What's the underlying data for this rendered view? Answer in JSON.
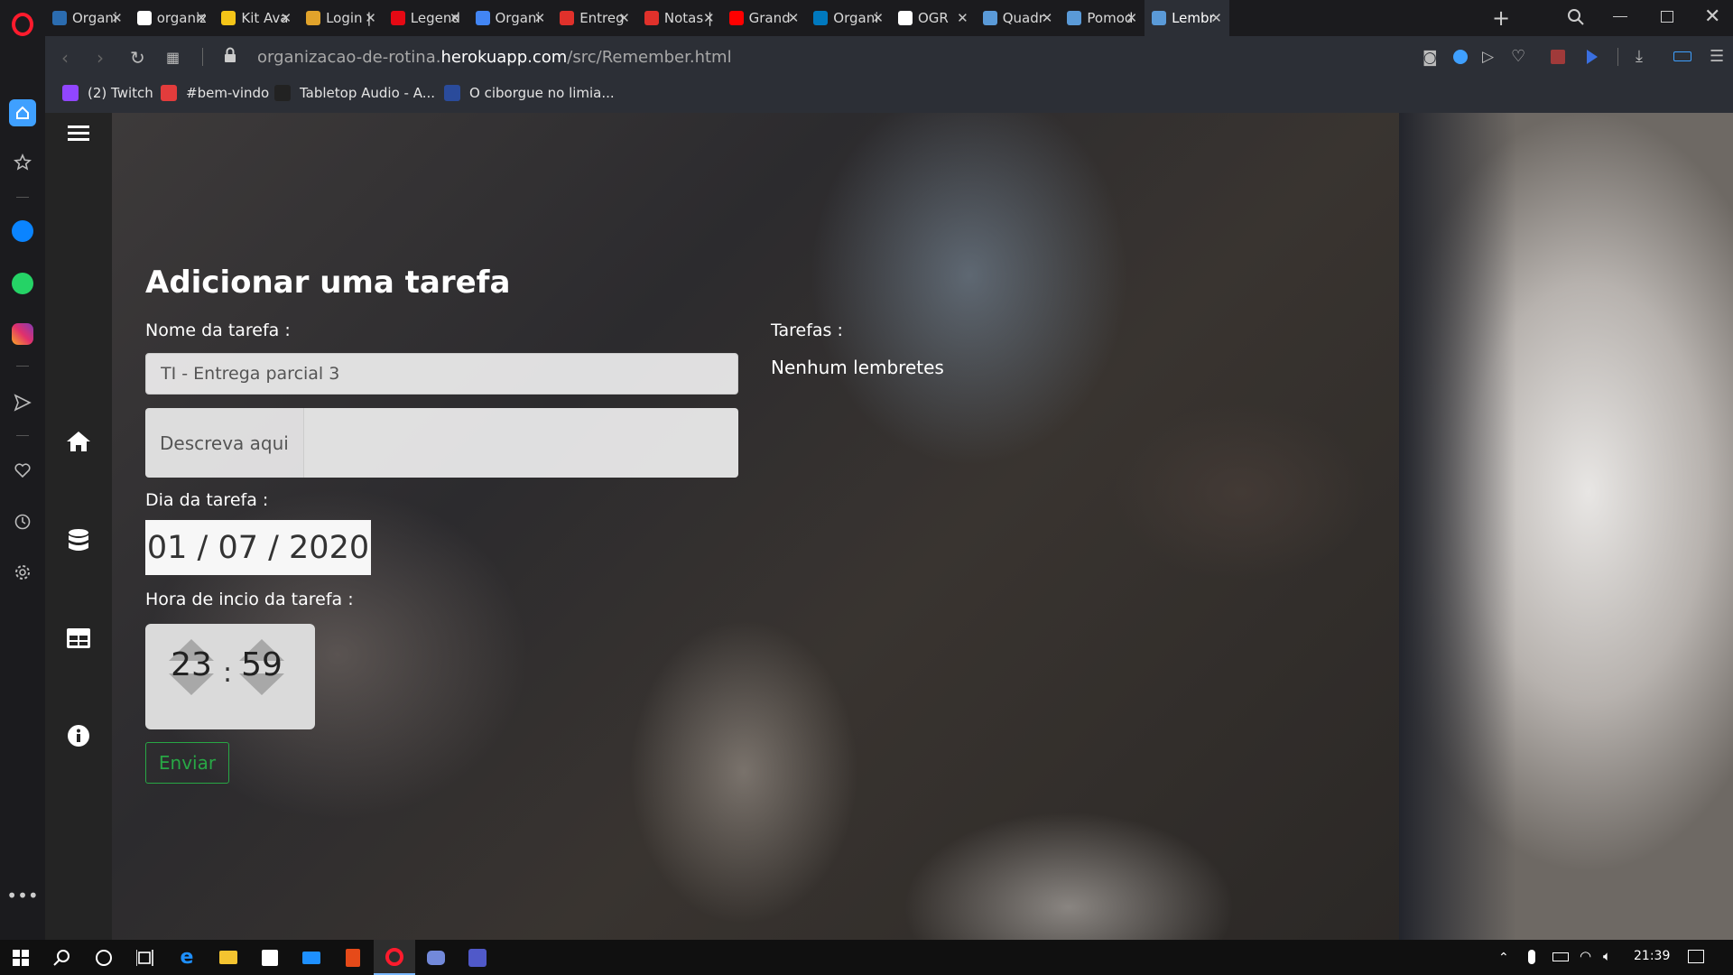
{
  "browser": {
    "tabs": [
      {
        "title": "Organi",
        "favicon": "m-logo-icon",
        "color": "#2b6cb0"
      },
      {
        "title": "organiz",
        "favicon": "github-icon",
        "color": "#ffffff"
      },
      {
        "title": "Kit Ava",
        "favicon": "lightning-icon",
        "color": "#f5c518"
      },
      {
        "title": "Login |",
        "favicon": "grid-icon",
        "color": "#e1a32b"
      },
      {
        "title": "Legend",
        "favicon": "b-logo-icon",
        "color": "#e50914"
      },
      {
        "title": "Organi",
        "favicon": "docs-icon",
        "color": "#4285f4"
      },
      {
        "title": "Entreg",
        "favicon": "ring-icon",
        "color": "#e0312b"
      },
      {
        "title": "Notas |",
        "favicon": "ring-icon",
        "color": "#e0312b"
      },
      {
        "title": "Grand",
        "favicon": "youtube-icon",
        "color": "#ff0000"
      },
      {
        "title": "Organi",
        "favicon": "trello-icon",
        "color": "#0079bf"
      },
      {
        "title": "OGR",
        "favicon": "file-icon",
        "color": "#ffffff"
      },
      {
        "title": "Quadr",
        "favicon": "heroku-icon",
        "color": "#5a9ad8"
      },
      {
        "title": "Pomod",
        "favicon": "heroku-icon",
        "color": "#5a9ad8"
      },
      {
        "title": "Lembr",
        "favicon": "heroku-icon",
        "color": "#5a9ad8",
        "active": true
      }
    ],
    "url_prefix": "organizacao-de-rotina.",
    "url_domain": "herokuapp.com",
    "url_path": "/src/Remember.html",
    "bookmarks": [
      {
        "label": "(2) Twitch",
        "favicon": "twitch-icon",
        "color": "#9146ff"
      },
      {
        "label": "#bem-vindo",
        "favicon": "discord-icon",
        "color": "#e23c3c"
      },
      {
        "label": "Tabletop Audio - A...",
        "favicon": "tabletop-icon",
        "color": "#222222"
      },
      {
        "label": "O ciborgue no limia...",
        "favicon": "e-logo-icon",
        "color": "#2a4b9b"
      }
    ]
  },
  "page": {
    "title": "Adicionar uma tarefa",
    "task_name_label": "Nome da tarefa :",
    "task_name_value": "TI - Entrega parcial 3",
    "description_prefix": "Descreva aqui",
    "date_label": "Dia da tarefa :",
    "date_value": "01 / 07 / 2020",
    "time_label": "Hora de incio da tarefa :",
    "hour": "23",
    "minute": "59",
    "time_separator": ":",
    "submit_label": "Enviar",
    "tasks_label": "Tarefas :",
    "tasks_empty": "Nenhum lembretes"
  },
  "taskbar": {
    "time": "21:39"
  },
  "colors": {
    "accent_green": "#28a745",
    "opera_red": "#ff1b2d",
    "sidebar_dark": "#242424"
  }
}
